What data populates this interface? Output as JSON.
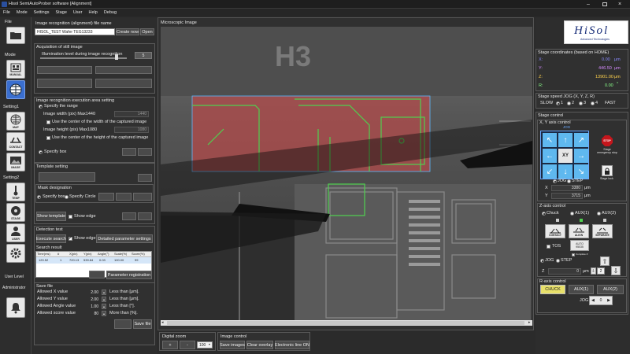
{
  "titlebar": {
    "title": "Hisol SemiAutoProber software [Alignment]"
  },
  "menu": [
    "File",
    "Mode",
    "Settings",
    "Stage",
    "User",
    "Help",
    "Debug"
  ],
  "sidebar": {
    "file_label": "File",
    "mode_label": "Mode",
    "manual_label": "MANUAL",
    "setting1_label": "Setting1",
    "map_label": "MAP",
    "contact_label": "CONTACT",
    "image_label": "IMAGE",
    "setting2_label": "Setting2",
    "temp_label": "TEMP",
    "stage_label": "STAGE",
    "user_label": "USER",
    "user_level_label": "User Level",
    "user_level_value": "Administrator"
  },
  "left_panel": {
    "file_name_title": "Image recognition (alignment) file name",
    "file_name_value": "HISOL_TEST Wafer TEG13233",
    "create_now": "Create now",
    "open": "Open",
    "acq_title": "Acquisition of still image",
    "illumination_label": "Illumination level during image recognition",
    "illumination_value": "5",
    "exec_area_title": "Image recognition execution area setting",
    "specify_range": "Specify the range",
    "image_width_label": "Image width (pix) Max1440",
    "image_width_value": "1440",
    "use_center_width": "Use the center of the width of the captured image",
    "image_height_label": "Image height (pix) Max1080",
    "image_height_value": "1080",
    "use_center_height": "Use the center of the height of the captured image",
    "specify_box": "Specify box",
    "template_title": "Template setting",
    "mask_title": "Mask designation",
    "mask_specify_box": "Specify box",
    "mask_specify_circle": "Specify Circle",
    "show_template": "Show template",
    "show_edge": "Show edge",
    "detection_title": "Detection test",
    "execute_search": "Execute search",
    "show_edge2": "Show edge",
    "detailed_params": "Detailed parameter settings",
    "search_result_label": "Search result",
    "result_columns": [
      "Time(ms)",
      "#",
      "X(pix)",
      "Y(pix)",
      "Angle(°)",
      "Scale(%)",
      "Score(%)"
    ],
    "result_rows": [
      [
        "120.52",
        "1",
        "720.13",
        "539.84",
        "0.03",
        "100.00",
        "99"
      ]
    ],
    "param_registration": "Parameter registration",
    "save_file_title": "Save file",
    "allowed_x_label": "Allowed X value",
    "allowed_x_value": "2.00",
    "allowed_x_unit": "Less than [μm].",
    "allowed_y_label": "Allowed Y value",
    "allowed_y_value": "2.00",
    "allowed_y_unit": "Less than [μm].",
    "allowed_angle_label": "Allowed Angle value",
    "allowed_angle_value": "1.00",
    "allowed_angle_unit": "Less than [°].",
    "allowed_score_label": "Allowed score value",
    "allowed_score_value": "80",
    "allowed_score_unit": "More than [%].",
    "save_file": "Save file"
  },
  "center": {
    "microscopic_title": "Microscopic Image",
    "chip_label": "H3",
    "digital_zoom_title": "Digital zoom",
    "zoom_plus": "+",
    "zoom_minus": "-",
    "zoom_value": "100",
    "image_control_title": "Image control",
    "save_images": "Save images",
    "clear_overlay": "Clear overlay",
    "electronic_line": "Electronic line ON"
  },
  "right_panel": {
    "logo_text": "HiSol",
    "logo_sub": "Advanced Technologies",
    "coords_title": "Stage coordinates (based on HOME)",
    "x_label": "X:",
    "x_value": "0.00",
    "x_unit": "μm",
    "y_label": "Y:",
    "y_value": "446.50",
    "y_unit": "μm",
    "z_label": "Z:",
    "z_value": "13901.00",
    "z_unit": "μm",
    "r_label": "R:",
    "r_value": "0.00",
    "r_unit": "°",
    "speed_title": "Stage speed JOG (X, Y, Z, R)",
    "speed_slow": "SLOW",
    "speed_options": [
      "1",
      "2",
      "3",
      "4"
    ],
    "speed_fast": "FAST",
    "stage_control_title": "Stage control",
    "xy_axis_title": "X, Y axis control",
    "jog_label": "JOG",
    "xy_button": "XY",
    "emergency_label": "Stage emergency stop",
    "stop_text": "STOP",
    "stage_lock_label": "Stage lock",
    "jog_radio": "JOG",
    "step_radio": "STEP",
    "xy_x_label": "X",
    "xy_x_value": "3380",
    "xy_x_unit": "μm",
    "xy_y_label": "Y",
    "xy_y_value": "3715",
    "xy_y_unit": "μm",
    "z_axis_title": "Z-axis control",
    "chuck_label": "Chuck",
    "aux1_label": "AUX(1)",
    "aux2_label": "AUX(2)",
    "contact_btn": "CONTACT",
    "align_btn": "ALIGN",
    "separate_btn": "SEPARATE",
    "tos_label": "TOS",
    "auto_label": "AUTO",
    "auto_value": "95035",
    "complete_label": "Complete Z",
    "z_jog": "JOG",
    "z_step": "STEP",
    "z_label2": "Z",
    "z_field_value": "0",
    "z_field_unit": "μm",
    "z_field2_value": "2",
    "r_axis_title": "R-axis control",
    "r_chuck": "CHUCK",
    "r_aux1": "AUX(1)",
    "r_aux2": "AUX(2)",
    "r_jog_label": "JOG",
    "r_value_box": "0"
  },
  "colors": {
    "accent_yellow": "#e8e06a",
    "coord_x": "#8a8aff",
    "coord_y": "#d58aff",
    "coord_z": "#ffd24d",
    "coord_r": "#8aff8a"
  }
}
